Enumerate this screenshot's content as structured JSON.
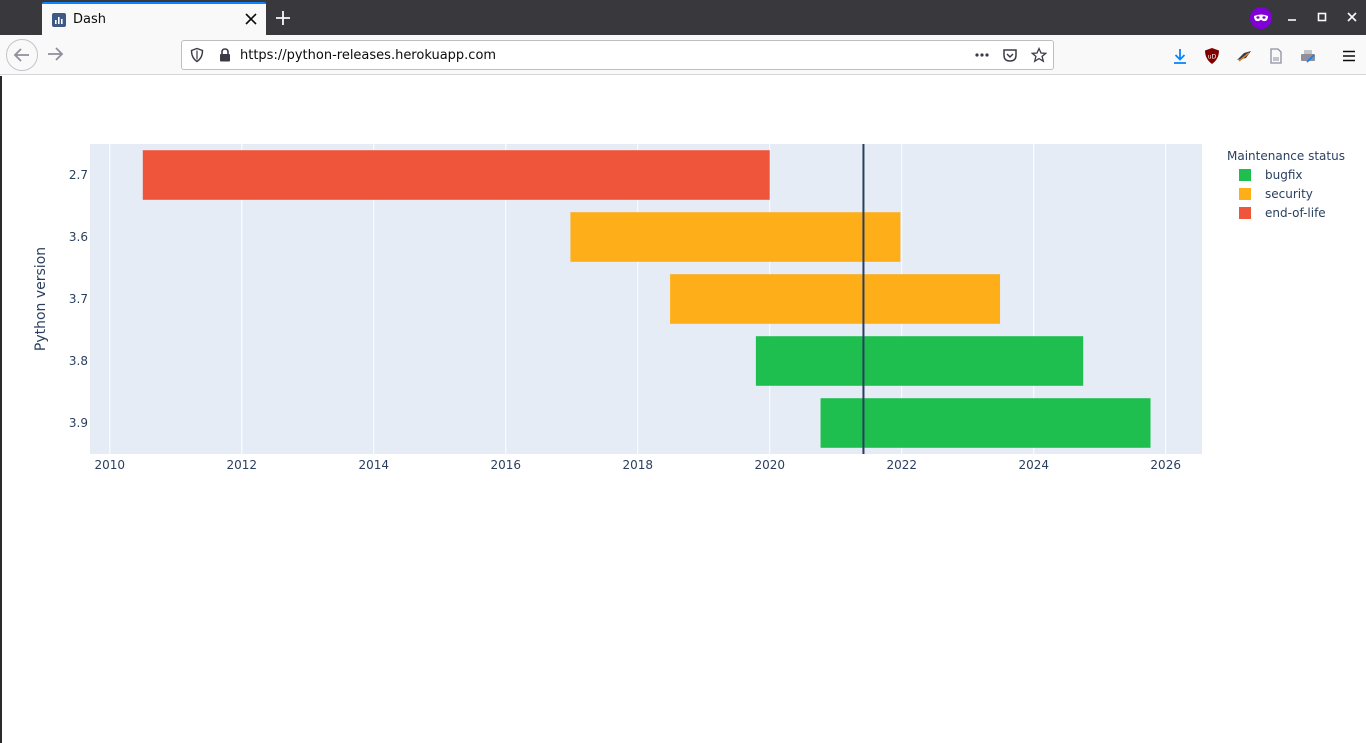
{
  "browser": {
    "tab_title": "Dash",
    "url": "https://python-releases.herokuapp.com"
  },
  "icons": {
    "tab_favicon": "dash-chart-icon",
    "tab_close": "close-icon",
    "new_tab": "plus-icon",
    "private_browsing": "private-mask-icon",
    "back": "arrow-left-icon",
    "forward": "arrow-right-icon",
    "tracking_protection": "shield-icon",
    "connection": "lock-icon",
    "page_actions": "ellipsis-icon",
    "pocket": "pocket-icon",
    "bookmark": "star-icon",
    "downloads": "download-icon",
    "ublock": "ublock-icon",
    "reader": "document-icon",
    "menu": "hamburger-icon"
  },
  "chart_data": {
    "type": "bar",
    "orientation": "horizontal-timeline",
    "title": "",
    "xlabel": "",
    "ylabel": "Python version",
    "categories": [
      "2.7",
      "3.6",
      "3.7",
      "3.8",
      "3.9"
    ],
    "bars": [
      {
        "version": "2.7",
        "start": 2010.5,
        "end": 2020.0,
        "status": "end-of-life"
      },
      {
        "version": "3.6",
        "start": 2016.98,
        "end": 2021.98,
        "status": "security"
      },
      {
        "version": "3.7",
        "start": 2018.49,
        "end": 2023.49,
        "status": "security"
      },
      {
        "version": "3.8",
        "start": 2019.79,
        "end": 2024.75,
        "status": "bugfix"
      },
      {
        "version": "3.9",
        "start": 2020.77,
        "end": 2025.77,
        "status": "bugfix"
      }
    ],
    "xlim": [
      2009.7,
      2026.55
    ],
    "x_ticks": [
      2010,
      2012,
      2014,
      2016,
      2018,
      2020,
      2022,
      2024,
      2026
    ],
    "current_date_line": 2021.42,
    "grid": true,
    "legend": {
      "title": "Maintenance status",
      "placement": "top-right",
      "items": [
        {
          "name": "bugfix",
          "color": "#1fbf4f"
        },
        {
          "name": "security",
          "color": "#fdae19"
        },
        {
          "name": "end-of-life",
          "color": "#ef553b"
        }
      ]
    },
    "colors": {
      "plot_background": "#e5ecf6",
      "grid": "#ffffff",
      "date_line": "#2a3f5f",
      "text": "#2a3f5f"
    }
  }
}
